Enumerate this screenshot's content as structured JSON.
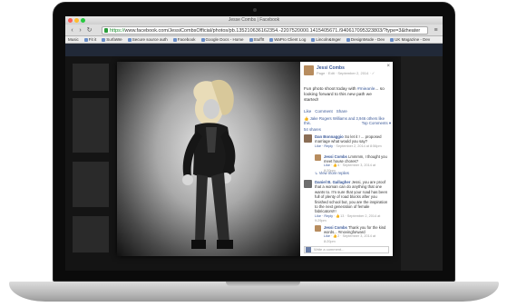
{
  "browser": {
    "window_title": "Jesse Combs | Facebook",
    "url_https": "https://",
    "url_rest": "www.facebook.com/JessiCombsOfficial/photos/pb.135210636162354.-2207520000.1415405671./940617095323803/?type=3&theater",
    "bookmarks": [
      "Music",
      "Fit it",
      "SurfaWe",
      "Secure source auth",
      "Facebook",
      "Google Docs - Home",
      "StuffIt",
      "WaPro Client Log",
      "Lincoln&Inger",
      "DesignMode - Dev",
      "UK Magazine - Dev"
    ]
  },
  "panel": {
    "author": "Jessi Combs",
    "meta": "Page · Edit · September 2, 2014 · ✓",
    "caption_pre": "Fun photo shoot today with ",
    "caption_link": "#mieanle",
    "caption_post": "... so looking forward to this new path we started!",
    "actions": [
      "Like",
      "Comment",
      "Share"
    ],
    "likes_text": "Jake Rogers Williams and 3,946 others like this.",
    "top_comments": "Top Comments ▾",
    "shares": "54 shares",
    "close": "×",
    "write_placeholder": "Write a comment..."
  },
  "comments": [
    {
      "name": "Dan Bonnaggio",
      "text": "So let it ! ... proposed marriage what would you say?",
      "meta_actions": "Like · Reply",
      "meta_time": "September 2, 2014 at 8:56pm",
      "reply": {
        "name": "Jessi Combs",
        "text": "Lmmmm, I thought you meet house chores?",
        "meta_actions": "Like",
        "meta_likes": "4",
        "meta_time": "September 3, 2014 at 8:20pm"
      },
      "more": "View more replies"
    },
    {
      "name": "Daniel B. Gallagher",
      "text": "Jessi, you are proof that a woman can do anything that one wants to. I'm sure that your road has been full of plenty of road blocks after you finished school but, you are the inspiration to the next generation of female fabricators!!!",
      "meta_actions": "Like · Reply",
      "meta_likes": "13",
      "meta_time": "September 2, 2014 at 9:29pm",
      "reply": {
        "name": "Jessi Combs",
        "text": "Thank you for the kind words... #movingforward",
        "meta_actions": "Like",
        "meta_likes": "2",
        "meta_time": "September 3, 2014 at 8:20pm"
      }
    }
  ],
  "colors": {
    "facebook_blue": "#3b5998",
    "https_green": "#1a8a2c"
  }
}
